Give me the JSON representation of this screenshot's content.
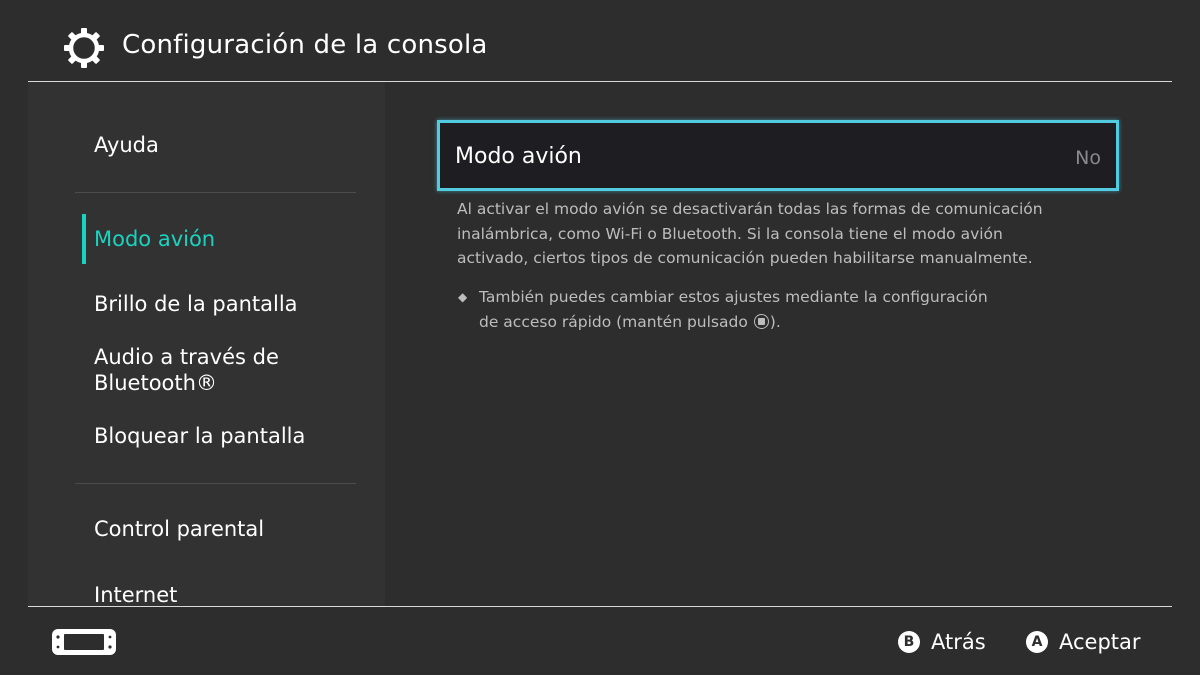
{
  "header": {
    "title": "Configuración de la consola",
    "icon": "gear-icon"
  },
  "sidebar": {
    "items": [
      {
        "label": "Ayuda",
        "active": false
      },
      {
        "label": "Modo avión",
        "active": true
      },
      {
        "label": "Brillo de la pantalla",
        "active": false
      },
      {
        "label": "Audio a través de",
        "label_line2": "Bluetooth®",
        "active": false
      },
      {
        "label": "Bloquear la pantalla",
        "active": false
      },
      {
        "label": "Control parental",
        "active": false
      },
      {
        "label": "Internet",
        "active": false
      }
    ],
    "active_color": "#19d3c0"
  },
  "main": {
    "setting": {
      "label": "Modo avión",
      "value": "No"
    },
    "description_lines": [
      "Al activar el modo avión se desactivarán todas las formas de comunicación",
      "inalámbrica, como Wi-Fi o Bluetooth. Si la consola tiene el modo avión",
      "activado, ciertos tipos de comunicación pueden habilitarse manualmente."
    ],
    "note": {
      "bullet": "◆",
      "line1": "También puedes cambiar estos ajustes mediante la configuración",
      "line2_before": "de acceso rápido (mantén pulsado ",
      "line2_after": ")."
    },
    "focus_color": "#52cbe0"
  },
  "footer": {
    "console_icon": "console-icon",
    "buttons": [
      {
        "key": "B",
        "label": "Atrás"
      },
      {
        "key": "A",
        "label": "Aceptar"
      }
    ]
  }
}
